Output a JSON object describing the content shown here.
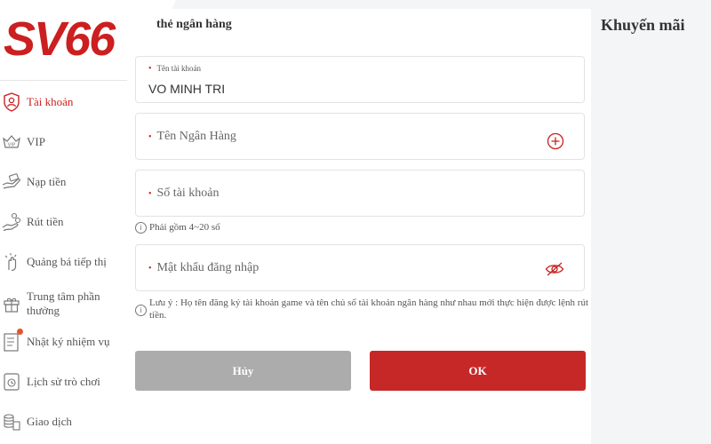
{
  "brand": {
    "logo_text": "SV66",
    "accent": "#cc1f1f"
  },
  "header": {
    "title": "thẻ ngân hàng",
    "promo_label": "Khuyến mãi"
  },
  "sidebar": {
    "items": [
      {
        "label": "Tài khoản",
        "icon": "account-shield-icon",
        "active": true
      },
      {
        "label": "VIP",
        "icon": "vip-crown-icon"
      },
      {
        "label": "Nạp tiền",
        "icon": "deposit-hand-icon"
      },
      {
        "label": "Rút tiền",
        "icon": "withdraw-coins-icon"
      },
      {
        "label": "Quảng bá tiếp thị",
        "icon": "promotion-hand-icon"
      },
      {
        "label": "Trung tâm phần thưởng",
        "icon": "gift-icon"
      },
      {
        "label": "Nhật ký nhiệm vụ",
        "icon": "task-log-icon",
        "badge": true
      },
      {
        "label": "Lịch sử trò chơi",
        "icon": "game-history-icon"
      },
      {
        "label": "Giao dịch",
        "icon": "transaction-coins-icon"
      }
    ]
  },
  "form": {
    "account_name_label": "Tên tài khoản",
    "account_name_value": "VO MINH TRI",
    "bank_name_placeholder": "Tên Ngân Hàng",
    "account_number_placeholder": "Số tài khoản",
    "account_number_hint": "Phải gồm 4~20 số",
    "password_placeholder": "Mật khẩu đăng nhập",
    "note": "Lưu ý : Họ tên đăng ký tài khoản game và tên chủ số tài khoản ngân hàng như nhau mới thực hiện được lệnh rút tiền.",
    "required_mark": "•",
    "info_mark": "i"
  },
  "buttons": {
    "cancel": "Hủy",
    "ok": "OK"
  }
}
